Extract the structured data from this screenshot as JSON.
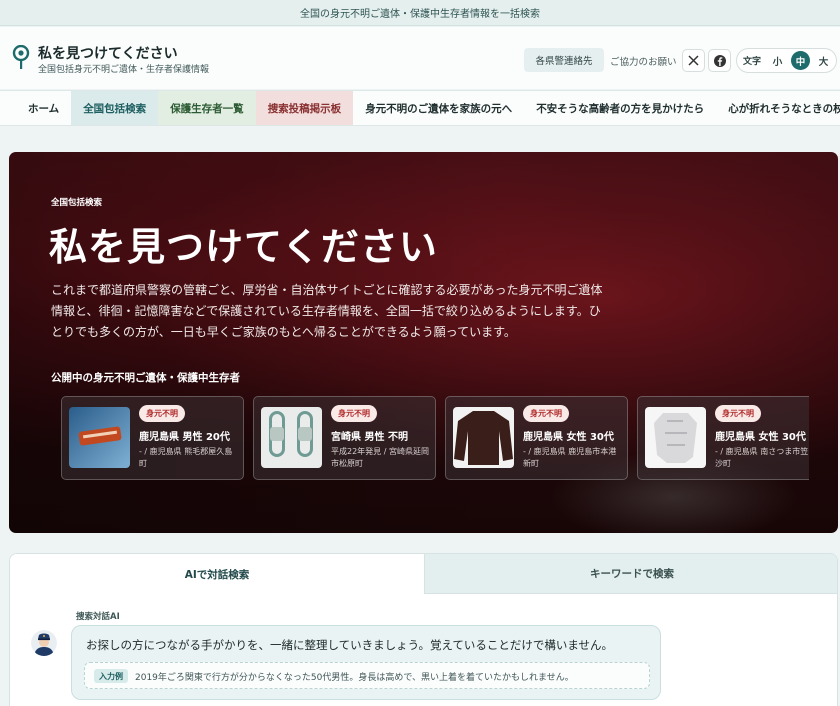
{
  "topbar": {
    "text": "全国の身元不明ご遺体・保護中生存者情報を一括検索"
  },
  "header": {
    "title": "私を見つけてください",
    "subtitle": "全国包括身元不明ご遺体・生存者保護情報",
    "police_button": "各県警連絡先",
    "support_link": "ご協力のお願い",
    "font_size": {
      "label": "文字",
      "options": [
        "小",
        "中",
        "大"
      ],
      "selected": "中"
    }
  },
  "nav": {
    "items": [
      "ホーム",
      "全国包括検索",
      "保護生存者一覧",
      "捜索投稿掲示板",
      "身元不明のご遺体を家族の元へ",
      "不安そうな高齢者の方を見かけたら",
      "心が折れそうなときの杖"
    ]
  },
  "hero": {
    "eyebrow": "全国包括検索",
    "title": "私を見つけてください",
    "description": "これまで都道府県警察の管轄ごと、厚労省・自治体サイトごとに確認する必要があった身元不明ご遺体情報と、徘徊・記憶障害などで保護されている生存者情報を、全国一括で絞り込めるようにします。ひとりでも多くの方が、一日も早くご家族のもとへ帰ることができるよう願っています。",
    "cards_title": "公開中の身元不明ご遺体・保護中生存者",
    "cards": [
      {
        "badge": "身元不明",
        "name": "鹿児島県 男性 20代",
        "place": "- / 鹿児島県 熊毛郡屋久島町"
      },
      {
        "badge": "身元不明",
        "name": "宮崎県 男性 不明",
        "place": "平成22年発見 / 宮崎県延岡市松原町"
      },
      {
        "badge": "身元不明",
        "name": "鹿児島県 女性 30代",
        "place": "- / 鹿児島県 鹿児島市本港新町"
      },
      {
        "badge": "身元不明",
        "name": "鹿児島県 女性 30代",
        "place": "- / 鹿児島県 南さつま市笠沙町"
      }
    ]
  },
  "search": {
    "tabs": [
      "AIで対話検索",
      "キーワードで検索"
    ],
    "active_tab": "AIで対話検索",
    "ai_label": "捜索対話AI",
    "message": "お探しの方につながる手がかりを、一緒に整理していきましょう。覚えていることだけで構いません。",
    "example_tag": "入力例",
    "example_text": "2019年ごろ関東で行方が分からなくなった50代男性。身長は高めで、黒い上着を着ていたかもしれません。"
  },
  "colors": {
    "accent": "#1d6b6b",
    "badge_text": "#b12c2c",
    "hero_bg": "#22070a"
  }
}
